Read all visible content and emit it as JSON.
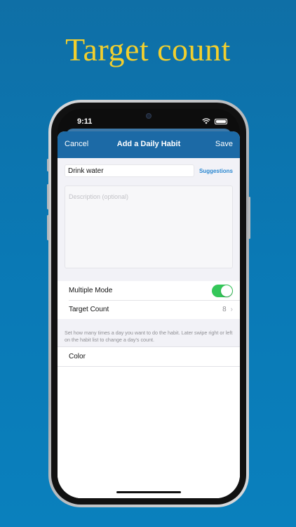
{
  "headline": "Target count",
  "status_bar": {
    "time": "9:11"
  },
  "navbar": {
    "cancel": "Cancel",
    "title": "Add a Daily Habit",
    "save": "Save"
  },
  "form": {
    "name_value": "Drink water",
    "suggestions_label": "Suggestions",
    "description_placeholder": "Description (optional)",
    "multiple_mode_label": "Multiple Mode",
    "multiple_mode_on": true,
    "target_count_label": "Target Count",
    "target_count_value": "8",
    "help_text": "Set how many times a day you want to do the habit. Later swipe right or left on the habit list to change a day's count.",
    "color_label": "Color"
  },
  "colors": {
    "background": "#0a79b5",
    "headline": "#f2cf2e",
    "navbar": "#1c6aa6",
    "toggle_on": "#34c759",
    "link": "#2a87d0"
  }
}
